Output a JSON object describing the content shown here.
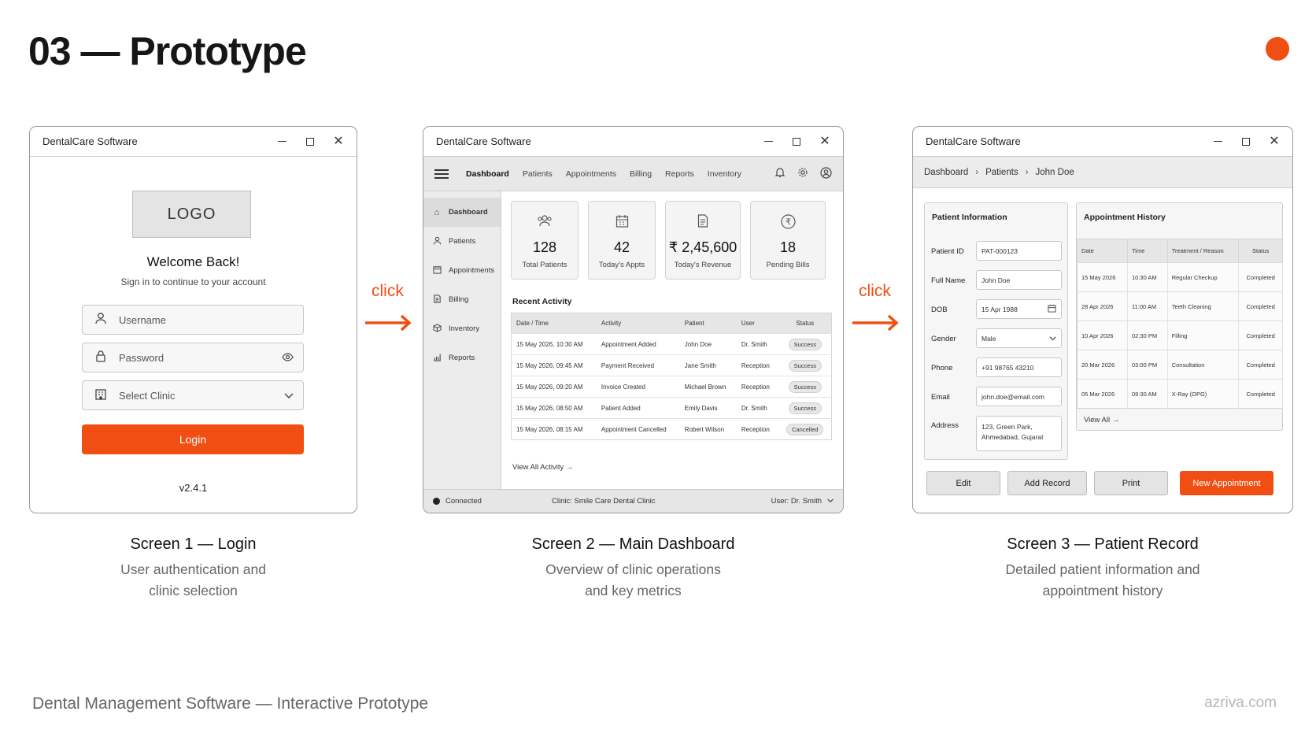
{
  "slide": {
    "title": "03 — Prototype",
    "accent_color": "#f04e12",
    "footer_left": "Dental Management Software — Interactive Prototype",
    "footer_right": "azriva.com"
  },
  "arrows": {
    "click_label": "click"
  },
  "screen1": {
    "window_title": "DentalCare Software",
    "logo": "LOGO",
    "welcome": "Welcome Back!",
    "subtitle": "Sign in to continue to your account",
    "username_placeholder": "Username",
    "password_placeholder": "Password",
    "clinic_placeholder": "Select Clinic",
    "login_label": "Login",
    "version": "v2.4.1",
    "caption_title": "Screen 1 — Login",
    "caption_line1": "User authentication and",
    "caption_line2": "clinic selection"
  },
  "screen2": {
    "window_title": "DentalCare Software",
    "menu": [
      "Dashboard",
      "Patients",
      "Appointments",
      "Billing",
      "Reports",
      "Inventory"
    ],
    "sidebar": [
      "Dashboard",
      "Patients",
      "Appointments",
      "Billing",
      "Inventory",
      "Reports"
    ],
    "metrics": [
      {
        "value": "128",
        "label": "Total Patients",
        "icon": "users-icon"
      },
      {
        "value": "42",
        "label": "Today's Appts",
        "icon": "calendar-icon"
      },
      {
        "value": "₹ 2,45,600",
        "label": "Today's Revenue",
        "icon": "document-icon"
      },
      {
        "value": "18",
        "label": "Pending Bills",
        "icon": "rupee-icon"
      }
    ],
    "recent_title": "Recent Activity",
    "activity_headers": [
      "Date / Time",
      "Activity",
      "Patient",
      "User",
      "Status"
    ],
    "activity_rows": [
      [
        "15 May 2026, 10:30 AM",
        "Appointment Added",
        "John Doe",
        "Dr. Smith",
        "Success"
      ],
      [
        "15 May 2026, 09:45 AM",
        "Payment Received",
        "Jane Smith",
        "Reception",
        "Success"
      ],
      [
        "15 May 2026, 09:20 AM",
        "Invoice Created",
        "Michael Brown",
        "Reception",
        "Success"
      ],
      [
        "15 May 2026, 08:50 AM",
        "Patient Added",
        "Emily Davis",
        "Dr. Smith",
        "Success"
      ],
      [
        "15 May 2026, 08:15 AM",
        "Appointment Cancelled",
        "Robert Wilson",
        "Reception",
        "Cancelled"
      ]
    ],
    "view_all": "View All Activity",
    "status_connected": "Connected",
    "status_clinic": "Clinic: Smile Care Dental Clinic",
    "status_user": "User: Dr. Smith",
    "caption_title": "Screen 2 — Main Dashboard",
    "caption_line1": "Overview of clinic operations",
    "caption_line2": "and key metrics"
  },
  "screen3": {
    "window_title": "DentalCare Software",
    "breadcrumb": [
      "Dashboard",
      "Patients",
      "John Doe"
    ],
    "info_title": "Patient Information",
    "fields": [
      {
        "label": "Patient ID",
        "value": "PAT-000123"
      },
      {
        "label": "Full Name",
        "value": "John Doe"
      },
      {
        "label": "DOB",
        "value": "15 Apr 1988"
      },
      {
        "label": "Gender",
        "value": "Male"
      },
      {
        "label": "Phone",
        "value": "+91 98765 43210"
      },
      {
        "label": "Email",
        "value": "john.doe@email.com"
      },
      {
        "label": "Address",
        "value_line1": "123, Green Park,",
        "value_line2": "Ahmedabad, Gujarat"
      }
    ],
    "history_title": "Appointment History",
    "history_headers": [
      "Date",
      "Time",
      "Treatment / Reason",
      "Status"
    ],
    "history_rows": [
      [
        "15 May 2026",
        "10:30 AM",
        "Regular Checkup",
        "Completed"
      ],
      [
        "28 Apr 2026",
        "11:00 AM",
        "Teeth Cleaning",
        "Completed"
      ],
      [
        "10 Apr 2026",
        "02:30 PM",
        "Filling",
        "Completed"
      ],
      [
        "20 Mar 2026",
        "03:00 PM",
        "Consultation",
        "Completed"
      ],
      [
        "05 Mar 2026",
        "09:30 AM",
        "X-Ray (OPG)",
        "Completed"
      ]
    ],
    "view_all": "View All",
    "buttons": [
      "Edit",
      "Add Record",
      "Print",
      "New Appointment"
    ],
    "caption_title": "Screen 3 — Patient Record",
    "caption_line1": "Detailed patient information and",
    "caption_line2": "appointment history"
  }
}
